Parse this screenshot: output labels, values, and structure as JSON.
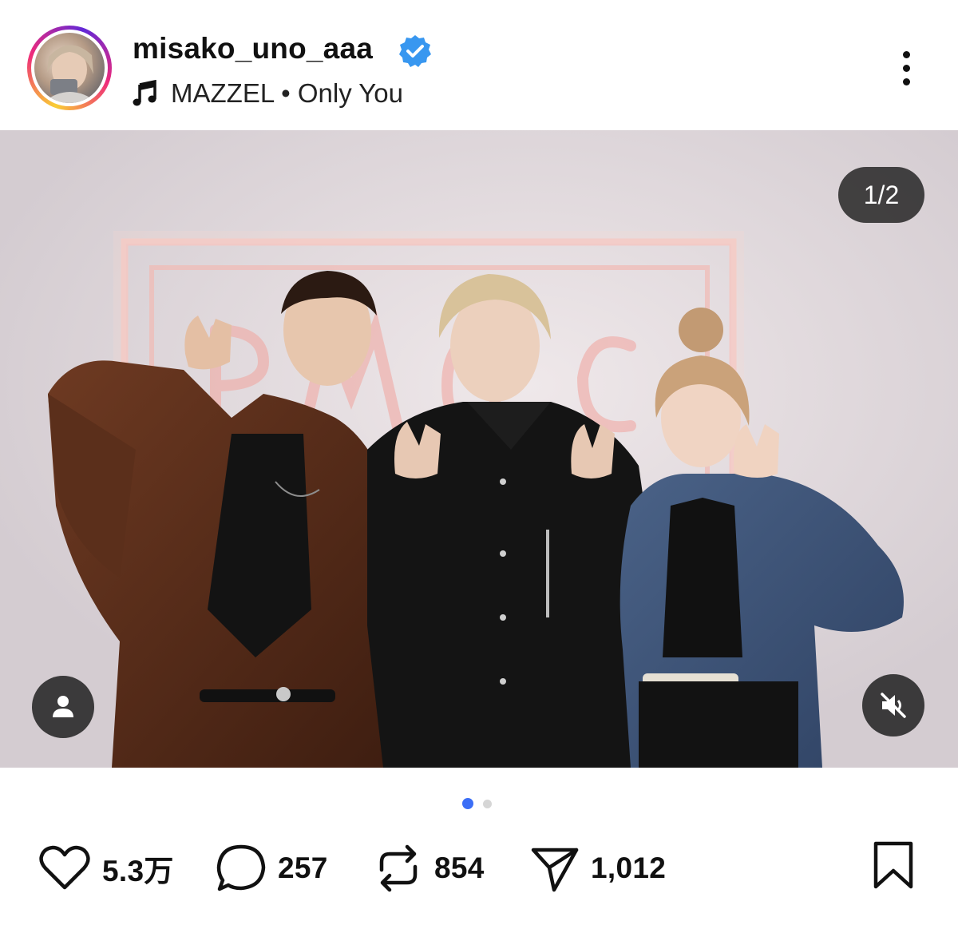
{
  "post": {
    "username": "misako_uno_aaa",
    "verified": true,
    "audio": {
      "artist": "MAZZEL",
      "separator": " • ",
      "track": "Only You"
    },
    "carousel": {
      "counter": "1/2",
      "current_index": 1,
      "total": 2
    },
    "actions": {
      "likes": "5.3万",
      "comments": "257",
      "reposts": "854",
      "shares": "1,012"
    }
  },
  "icons": {
    "verified": "verified-badge-icon",
    "music": "music-note-icon",
    "more": "more-options-icon",
    "user_tag": "user-tag-icon",
    "mute": "muted-speaker-icon",
    "like": "heart-icon",
    "comment": "comment-icon",
    "repost": "repost-icon",
    "share": "send-icon",
    "save": "bookmark-icon"
  },
  "colors": {
    "verified_blue": "#3897f0",
    "active_dot": "#3b6ef6",
    "inactive_dot": "#d6d6d6",
    "overlay_button": "#262626"
  }
}
